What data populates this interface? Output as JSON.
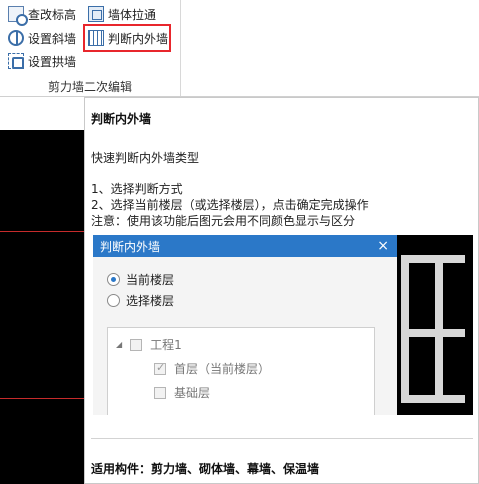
{
  "ribbon": {
    "buttons": [
      {
        "label": "查改标高",
        "icon": "elevation-icon"
      },
      {
        "label": "墙体拉通",
        "icon": "wall-extend-icon"
      },
      {
        "label": "设置斜墙",
        "icon": "slant-wall-icon"
      },
      {
        "label": "判断内外墙",
        "icon": "inner-outer-wall-icon"
      },
      {
        "label": "设置拱墙",
        "icon": "arch-wall-icon"
      }
    ],
    "group_label": "剪力墙二次编辑",
    "highlight_color": "#e8262c"
  },
  "tooltip": {
    "title": "判断内外墙",
    "description": "快速判断内外墙类型",
    "steps": [
      "1、选择判断方式",
      "2、选择当前楼层（或选择楼层），点击确定完成操作",
      "注意：使用该功能后图元会用不同颜色显示与区分"
    ],
    "footer": "适用构件：剪力墙、砌体墙、幕墙、保温墙"
  },
  "dialog": {
    "title": "判断内外墙",
    "close": "×",
    "radio_current_floor": "当前楼层",
    "radio_select_floor": "选择楼层",
    "tree": {
      "project": "工程1",
      "floor_first": "首层（当前楼层）",
      "floor_base": "基础层"
    },
    "title_color": "#2b78c8"
  }
}
